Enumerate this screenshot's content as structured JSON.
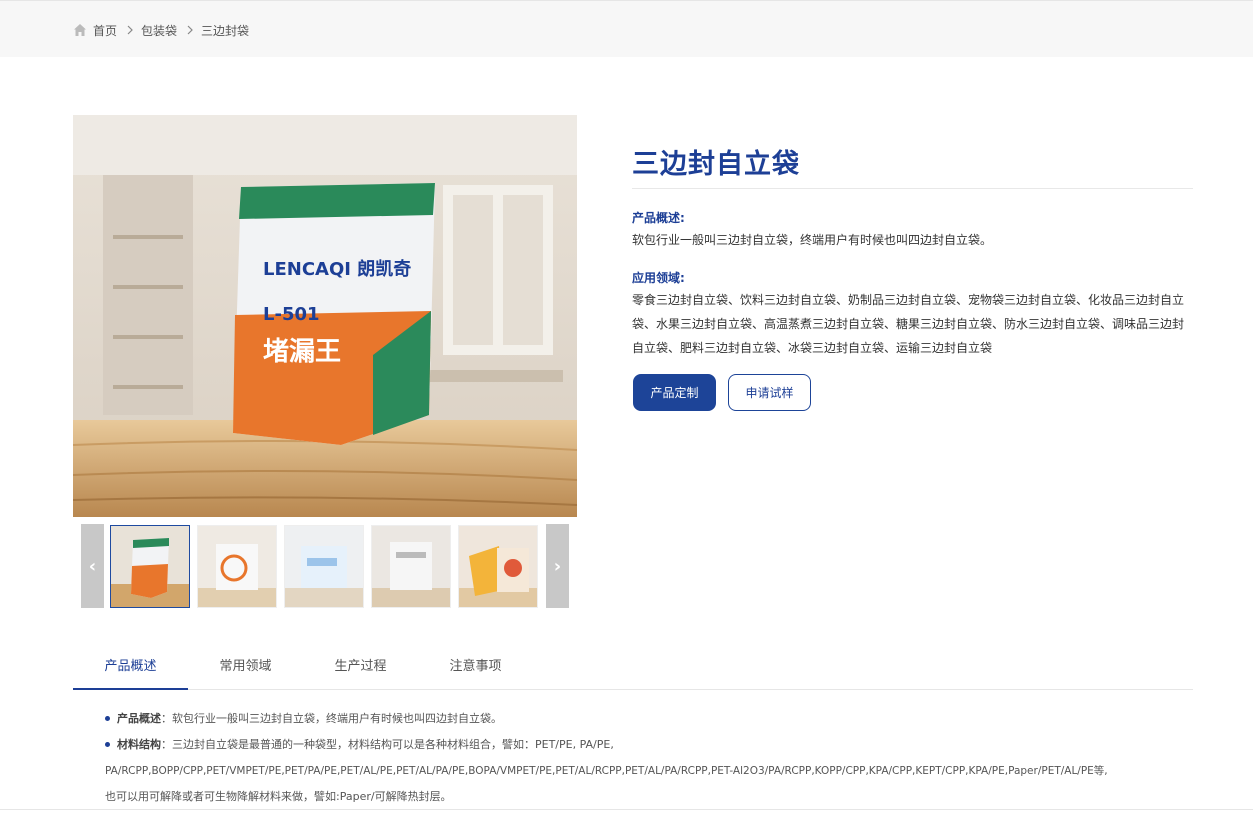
{
  "breadcrumb": {
    "home": "首页",
    "category": "包装袋",
    "current": "三边封袋"
  },
  "product": {
    "title": "三边封自立袋",
    "overview_label": "产品概述:",
    "overview_text": "软包行业一般叫三边封自立袋，终端用户有时候也叫四边封自立袋。",
    "application_label": "应用领域:",
    "application_text": "零食三边封自立袋、饮料三边封自立袋、奶制品三边封自立袋、宠物袋三边封自立袋、化妆品三边封自立袋、水果三边封自立袋、高温蒸煮三边封自立袋、糖果三边封自立袋、防水三边封自立袋、调味品三边封自立袋、肥料三边封自立袋、冰袋三边封自立袋、运输三边封自立袋",
    "customize_button": "产品定制",
    "sample_button": "申请试样"
  },
  "gallery": {
    "prev": "‹",
    "next": "›",
    "package_brand": "LENCAQI 朗凯奇",
    "package_model": "L-501",
    "package_name": "堵漏王"
  },
  "tabs": [
    "产品概述",
    "常用领域",
    "生产过程",
    "注意事项"
  ],
  "details": {
    "item1_label": "产品概述",
    "item1_text": "：软包行业一般叫三边封自立袋，终端用户有时候也叫四边封自立袋。",
    "item2_label": "材料结构",
    "item2_text": "：三边封自立袋是最普通的一种袋型，材料结构可以是各种材料组合，譬如：PET/PE, PA/PE,",
    "line3": "PA/RCPP,BOPP/CPP,PET/VMPET/PE,PET/PA/PE,PET/AL/PE,PET/AL/PA/PE,BOPA/VMPET/PE,PET/AL/RCPP,PET/AL/PA/RCPP,PET-Al2O3/PA/RCPP,KOPP/CPP,KPA/CPP,KEPT/CPP,KPA/PE,Paper/PET/AL/PE等,",
    "line4": "也可以用可解降或者可生物降解材料来做，譬如:Paper/可解降热封层。"
  },
  "colors": {
    "accent": "#1d3f96",
    "button": "#1d4498",
    "topbar": "#f7f7f7"
  }
}
